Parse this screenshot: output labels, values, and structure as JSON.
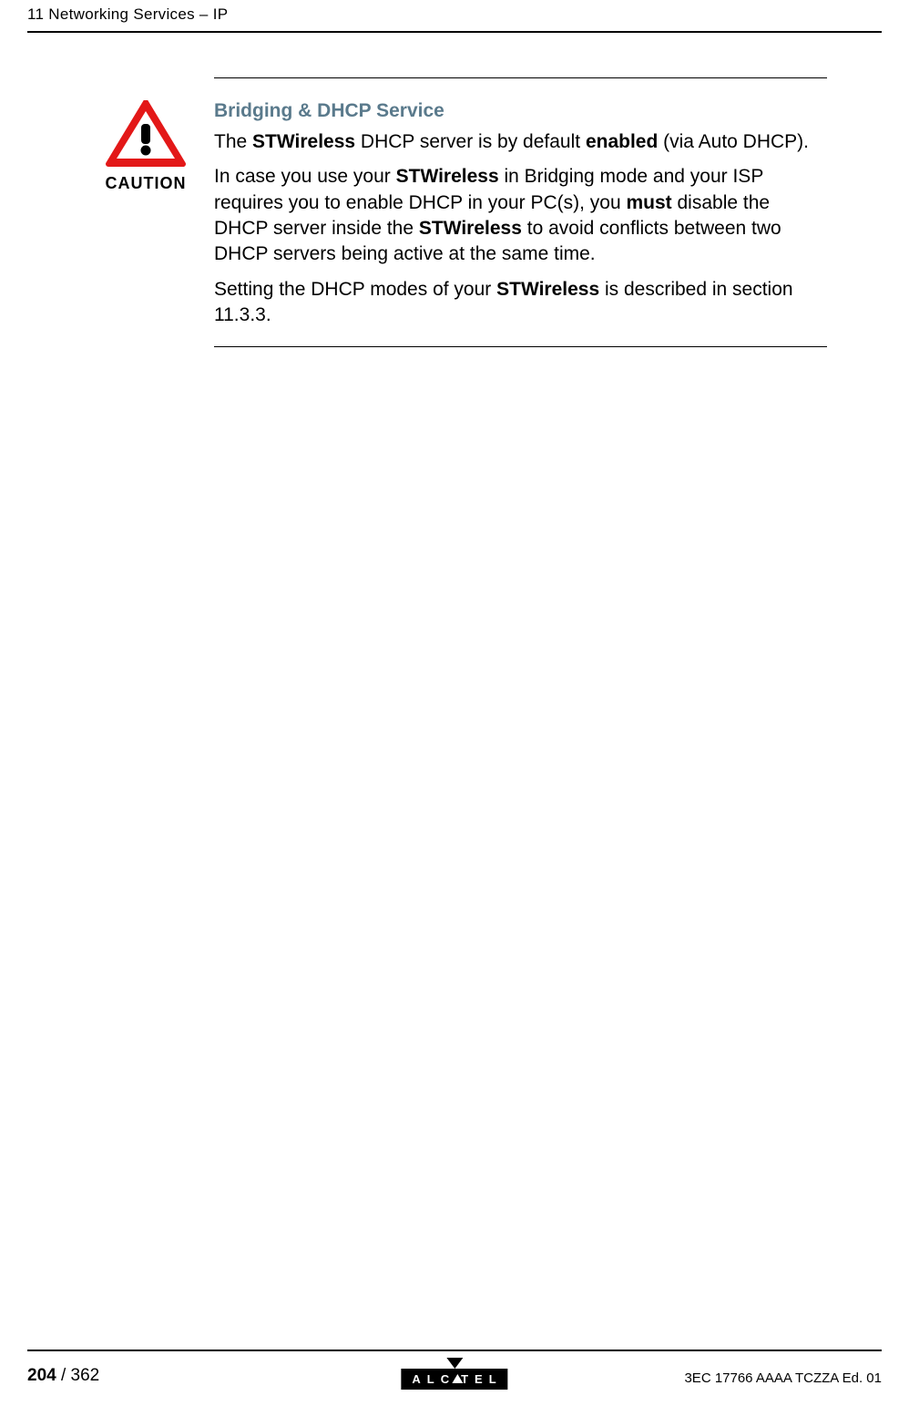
{
  "header": {
    "breadcrumb": "11 Networking Services – IP"
  },
  "caution": {
    "label": "CAUTION",
    "title": "Bridging & DHCP Service",
    "p1_a": "The ",
    "p1_b": "STWireless",
    "p1_c": " DHCP server is by default ",
    "p1_d": "enabled",
    "p1_e": " (via Auto DHCP).",
    "p2_a": "In case you use your ",
    "p2_b": "STWireless",
    "p2_c": " in Bridging mode and your ISP requires you to enable DHCP in your PC(s), you ",
    "p2_d": "must",
    "p2_e": " disable the DHCP server inside the ",
    "p2_f": "STWireless",
    "p2_g": " to avoid conflicts between two DHCP servers being active at the same time.",
    "p3_a": "Setting the DHCP modes of your ",
    "p3_b": "STWireless",
    "p3_c": " is described in section 11.3.3."
  },
  "footer": {
    "page_current": "204",
    "page_sep": " / ",
    "page_total": "362",
    "doc_id": "3EC 17766 AAAA TCZZA Ed. 01",
    "brand_letters_a": "ALC",
    "brand_letters_b": "TEL"
  }
}
